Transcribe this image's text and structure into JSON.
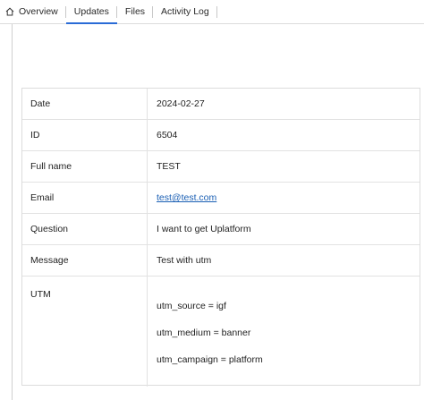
{
  "tabs": [
    {
      "label": "Overview",
      "icon": "home-icon",
      "active": false
    },
    {
      "label": "Updates",
      "active": true
    },
    {
      "label": "Files",
      "active": false
    },
    {
      "label": "Activity Log",
      "active": false
    }
  ],
  "record": {
    "date": {
      "label": "Date",
      "value": "2024-02-27"
    },
    "id": {
      "label": "ID",
      "value": "6504"
    },
    "full_name": {
      "label": "Full name",
      "value": "TEST"
    },
    "email": {
      "label": "Email",
      "value": "test@test.com"
    },
    "question": {
      "label": "Question",
      "value": "I want to get Uplatform"
    },
    "message": {
      "label": "Message",
      "value": "Test with utm"
    },
    "utm": {
      "label": "UTM",
      "lines": [
        "utm_source = igf",
        "utm_medium = banner",
        "utm_campaign = platform"
      ]
    }
  },
  "colors": {
    "active_tab_underline": "#2a6bd6",
    "link": "#1a5fb4"
  }
}
